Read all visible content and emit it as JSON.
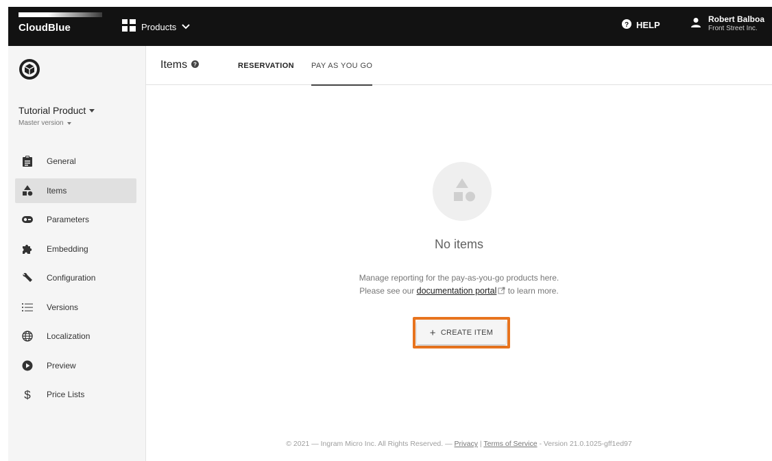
{
  "topbar": {
    "logo_text": "CloudBlue",
    "products_label": "Products",
    "help_label": "HELP",
    "user_name": "Robert Balboa",
    "user_company": "Front Street Inc."
  },
  "sidebar": {
    "product_name": "Tutorial Product",
    "product_version": "Master version",
    "items": [
      {
        "label": "General",
        "icon": "clipboard-icon"
      },
      {
        "label": "Items",
        "icon": "shapes-icon",
        "active": true
      },
      {
        "label": "Parameters",
        "icon": "toggle-icon"
      },
      {
        "label": "Embedding",
        "icon": "puzzle-icon"
      },
      {
        "label": "Configuration",
        "icon": "wrench-icon"
      },
      {
        "label": "Versions",
        "icon": "list-numbered-icon"
      },
      {
        "label": "Localization",
        "icon": "globe-icon"
      },
      {
        "label": "Preview",
        "icon": "play-icon"
      },
      {
        "label": "Price Lists",
        "icon": "dollar-icon"
      }
    ]
  },
  "main": {
    "title": "Items",
    "tabs": [
      {
        "label": "RESERVATION"
      },
      {
        "label": "PAY AS YOU GO",
        "active": true
      }
    ],
    "empty": {
      "title": "No items",
      "line1": "Manage reporting for the pay-as-you-go products here.",
      "line2_prefix": "Please see our",
      "link_text": "documentation portal",
      "line2_suffix": "to learn more."
    },
    "create_button": "CREATE ITEM",
    "highlight_color": "#e8741e"
  },
  "footer": {
    "copyright": "© 2021 — Ingram Micro Inc. All Rights Reserved. —",
    "privacy": "Privacy",
    "separator": "|",
    "terms": "Terms of Service",
    "version": "- Version 21.0.1025-gff1ed97"
  }
}
